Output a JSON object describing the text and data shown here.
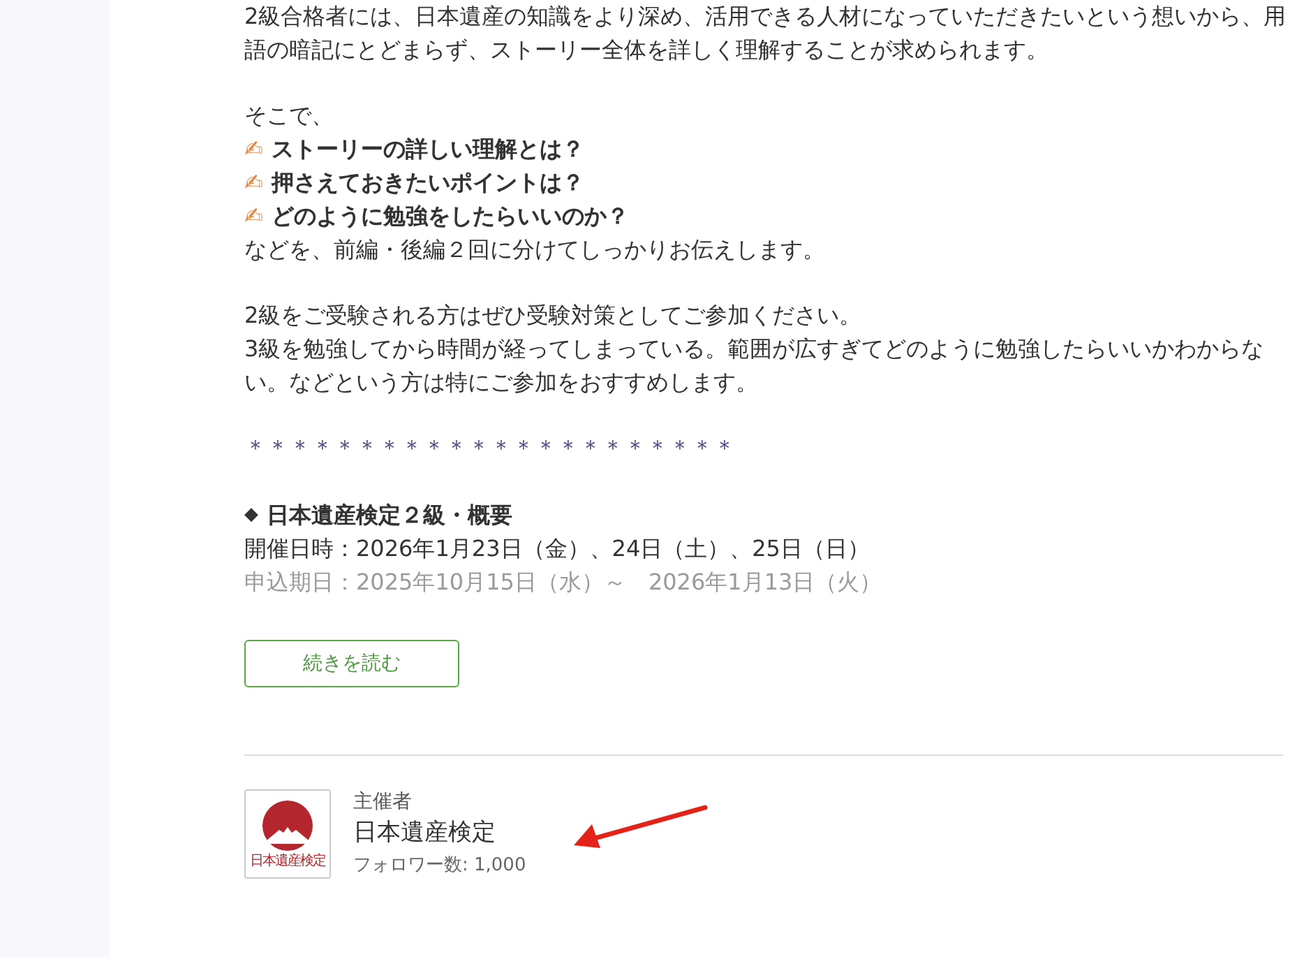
{
  "intro_lines": [
    "2級合格者には、日本遺産の知識をより深め、活用できる人材になっていただきたいという想いから、用",
    "語の暗記にとどまらず、ストーリー全体を詳しく理解することが求められます。"
  ],
  "lead": "そこで、",
  "points": [
    {
      "icon": "✍",
      "text": "ストーリーの詳しい理解とは？"
    },
    {
      "icon": "✍",
      "text": "押さえておきたいポイントは？"
    },
    {
      "icon": "✍",
      "text": "どのように勉強をしたらいいのか？"
    }
  ],
  "after_points": "などを、前編・後編２回に分けてしっかりお伝えします。",
  "paragraph_lines": [
    "2級をご受験される方はぜひ受験対策としてご参加ください。",
    "3級を勉強してから時間が経ってしまっている。範囲が広すぎてどのように勉強したらいいかわからな",
    "い。などという方は特にご参加をおすすめします。"
  ],
  "separator": "＊＊＊＊＊＊＊＊＊＊＊＊＊＊＊＊＊＊＊＊＊＊",
  "summary": {
    "marker": "◆",
    "title": "日本遺産検定２級・概要",
    "lines": [
      {
        "text": "開催日時：2026年1月23日（金）、24日（土）、25日（日）",
        "faded": false
      },
      {
        "text": "申込期日：2025年10月15日（水）～　2026年1月13日（火）",
        "faded": true
      }
    ]
  },
  "read_more_button": "続きを読む",
  "organizer": {
    "label": "主催者",
    "name": "日本遺産検定",
    "followers": "フォロワー数: 1,000",
    "logo_text": "日本遺産検定"
  }
}
